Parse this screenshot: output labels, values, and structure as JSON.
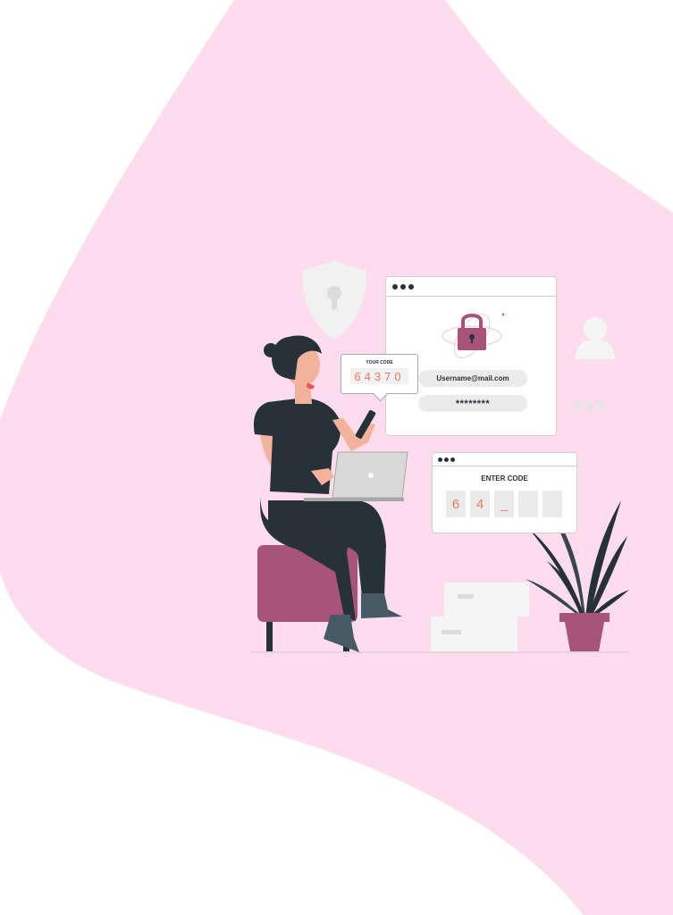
{
  "illustration": {
    "background_blob_color": "#fcdced",
    "accent_color": "#a8547a",
    "icons": [
      "shield-keyhole-icon",
      "padlock-icon",
      "user-icon",
      "plant-icon",
      "laptop-icon",
      "smartphone-icon"
    ]
  },
  "code_bubble": {
    "label": "YOUR CODE",
    "code": "64370"
  },
  "login_window": {
    "username": "Username@mail.com",
    "password_mask": "********"
  },
  "enter_code_window": {
    "title": "ENTER CODE",
    "digits": [
      "6",
      "4",
      "_",
      "",
      ""
    ]
  },
  "password_hint": "***"
}
